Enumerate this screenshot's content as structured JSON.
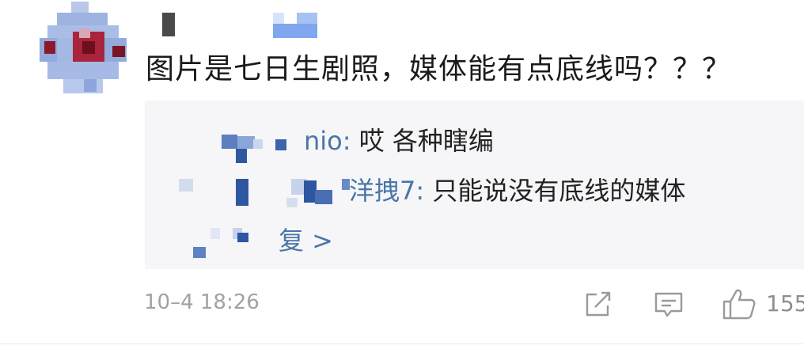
{
  "comment": {
    "text": "图片是七日生剧照，媒体能有点底线吗？？？",
    "time": "10–4 18:26",
    "like_count": "155"
  },
  "replies": [
    {
      "name": "nio:",
      "text": "哎 各种瞎编"
    },
    {
      "name": "洋拽7:",
      "text": "只能说没有底线的媒体"
    }
  ],
  "more_replies_label": "复 >",
  "icons": {
    "share": "share-icon",
    "comment": "comment-icon",
    "like": "thumbs-up-icon"
  },
  "colors": {
    "link": "#4a76a8",
    "text": "#1a1a1a",
    "reply_bg": "#f6f6f8",
    "meta": "#a2a2a2"
  }
}
